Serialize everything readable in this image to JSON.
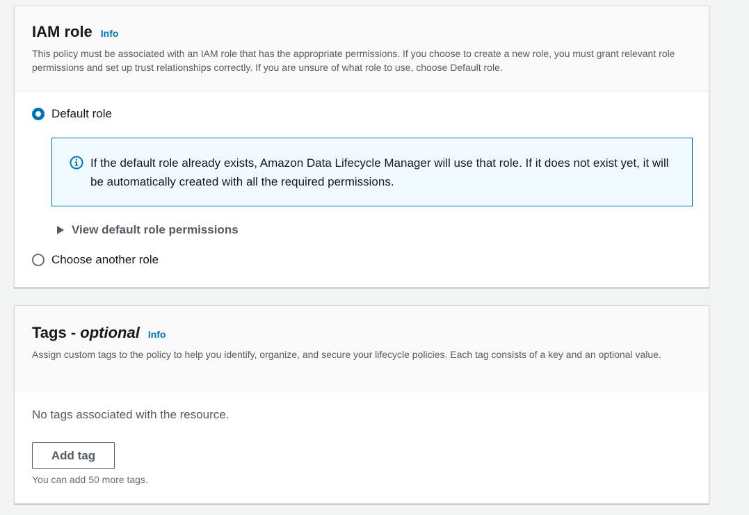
{
  "iam_role": {
    "title": "IAM role",
    "info_label": "Info",
    "description": "This policy must be associated with an IAM role that has the appropriate permissions. If you choose to create a new role, you must grant relevant role permissions and set up trust relationships correctly. If you are unsure of what role to use, choose Default role.",
    "options": [
      {
        "label": "Default role",
        "selected": true
      },
      {
        "label": "Choose another role",
        "selected": false
      }
    ],
    "alert_text": "If the default role already exists, Amazon Data Lifecycle Manager will use that role. If it does not exist yet, it will be automatically created with all the required permissions.",
    "expander_label": "View default role permissions"
  },
  "tags": {
    "title": "Tags - ",
    "title_optional": "optional",
    "info_label": "Info",
    "description": "Assign custom tags to the policy to help you identify, organize, and secure your lifecycle policies. Each tag consists of a key and an optional value.",
    "empty_text": "No tags associated with the resource.",
    "add_button_label": "Add tag",
    "hint": "You can add 50 more tags."
  },
  "icons": {
    "alert": "info-circle-icon",
    "expander": "caret-right-icon"
  },
  "colors": {
    "accent": "#0073bb",
    "alert_bg": "#f1faff",
    "page_bg": "#f2f3f3"
  }
}
